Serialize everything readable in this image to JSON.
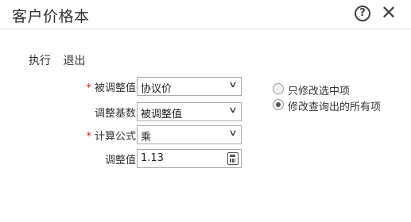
{
  "dialog": {
    "title": "客户价格本",
    "help_icon": "help-circle-icon",
    "close_icon": "close-icon"
  },
  "toolbar": {
    "execute_label": "执行",
    "exit_label": "退出"
  },
  "form": {
    "adjusted_value": {
      "label": "被调整值",
      "required": "*",
      "value": "协议价"
    },
    "adjust_base": {
      "label": "调整基数",
      "value": "被调整值"
    },
    "formula": {
      "label": "计算公式",
      "required": "*",
      "value": "乘"
    },
    "adjust_amount": {
      "label": "调整值",
      "value": "1.13"
    }
  },
  "scope": {
    "options": [
      {
        "label": "只修改选中项",
        "checked": false
      },
      {
        "label": "修改查询出的所有项",
        "checked": true
      }
    ]
  }
}
